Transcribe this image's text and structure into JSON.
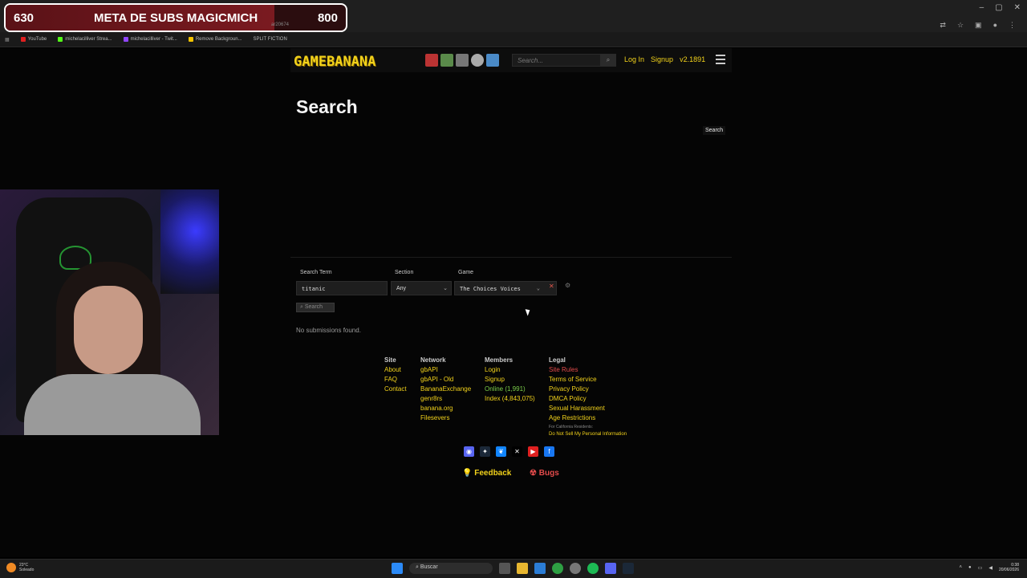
{
  "overlay": {
    "current": "630",
    "goal_text": "META DE SUBS MAGICMICH",
    "target": "800",
    "progress": 0.79,
    "small_text": "ar20674"
  },
  "browser": {
    "bookmarks": [
      "YouTube",
      "michelacilliver Strea...",
      "michelacilliver - Twit...",
      "Remove Backgroun...",
      "SPLIT FICTION"
    ],
    "window_controls": [
      "–",
      "▢",
      "✕"
    ]
  },
  "header": {
    "logo": "GAMEBANANA",
    "search_placeholder": "Search...",
    "login": "Log In",
    "signup": "Signup",
    "version": "v2.1891"
  },
  "main": {
    "title": "Search",
    "mini_search": "Search",
    "search_term_label": "Search Term",
    "search_term_value": "titanic",
    "section_label": "Section",
    "section_value": "Any",
    "game_label": "Game",
    "game_value": "The Choices Voices",
    "search_button": "Search",
    "no_results": "No submissions found."
  },
  "footer": {
    "site": {
      "heading": "Site",
      "links": [
        "About",
        "FAQ",
        "Contact"
      ]
    },
    "network": {
      "heading": "Network",
      "links": [
        "gbAPI",
        "gbAPI - Old",
        "BananaExchange",
        "genr8rs",
        "banana.org",
        "Filesevers"
      ]
    },
    "members": {
      "heading": "Members",
      "login": "Login",
      "signup": "Signup",
      "online": "Online (1,991)",
      "index": "Index (4,843,075)"
    },
    "legal": {
      "heading": "Legal",
      "site_rules": "Site Rules",
      "links": [
        "Terms of Service",
        "Privacy Policy",
        "DMCA Policy",
        "Sexual Harassment",
        "Age Restrictions"
      ]
    },
    "california_note": "For California Residents:",
    "do_not_sell": "Do Not Sell My Personal Information",
    "feedback": "Feedback",
    "bugs": "Bugs"
  },
  "taskbar": {
    "weather_temp": "23°C",
    "weather_desc": "Soleado",
    "search_placeholder": "Buscar",
    "time": "0:38",
    "date": "20/06/2026"
  },
  "colors": {
    "accent": "#f2d21b",
    "danger": "#e34b4b",
    "online": "#7ccf4a"
  }
}
